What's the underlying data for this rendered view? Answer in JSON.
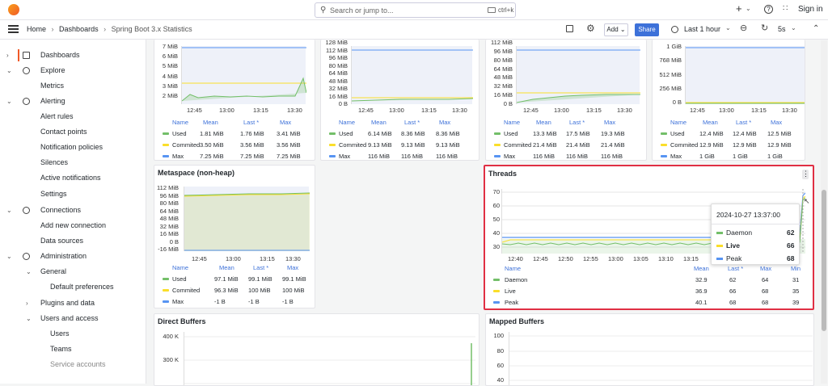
{
  "topbar": {
    "search_placeholder": "Search or jump to...",
    "shortcut": "ctrl+k",
    "plus": "+",
    "sign_in": "Sign in"
  },
  "breadcrumb": {
    "home": "Home",
    "sep1": "›",
    "dashboards": "Dashboards",
    "sep2": "›",
    "current": "Spring Boot 3.x Statistics"
  },
  "toolbar": {
    "add": "Add",
    "share": "Share",
    "time_range": "Last 1 hour",
    "refresh": "5s"
  },
  "sidebar": {
    "items": [
      {
        "label": "Dashboards",
        "chev": "›",
        "active": true
      },
      {
        "label": "Explore",
        "chev": "⌄"
      },
      {
        "label": "Metrics"
      },
      {
        "label": "Alerting",
        "chev": "⌄"
      },
      {
        "label": "Alert rules"
      },
      {
        "label": "Contact points"
      },
      {
        "label": "Notification policies"
      },
      {
        "label": "Silences"
      },
      {
        "label": "Active notifications"
      },
      {
        "label": "Settings"
      },
      {
        "label": "Connections",
        "chev": "⌄"
      },
      {
        "label": "Add new connection"
      },
      {
        "label": "Data sources"
      },
      {
        "label": "Administration",
        "chev": "⌄"
      },
      {
        "label": "General",
        "chev": "⌄"
      },
      {
        "label": "Default preferences"
      },
      {
        "label": "Plugins and data",
        "chev": "›"
      },
      {
        "label": "Users and access",
        "chev": "⌄"
      },
      {
        "label": "Users"
      },
      {
        "label": "Teams"
      },
      {
        "label": "Service accounts"
      }
    ]
  },
  "legend_headers": {
    "name": "Name",
    "mean": "Mean",
    "last": "Last *",
    "max": "Max",
    "min": "Min"
  },
  "legend_names": {
    "used": "Used",
    "committed": "Commited",
    "max": "Max"
  },
  "x_ticks_4": [
    "12:45",
    "13:00",
    "13:15",
    "13:30"
  ],
  "panel1": {
    "y_ticks": [
      "7 MiB",
      "6 MiB",
      "5 MiB",
      "4 MiB",
      "3 MiB",
      "2 MiB"
    ],
    "rows": [
      [
        "1.81 MiB",
        "1.76 MiB",
        "3.41 MiB"
      ],
      [
        "3.50 MiB",
        "3.56 MiB",
        "3.56 MiB"
      ],
      [
        "7.25 MiB",
        "7.25 MiB",
        "7.25 MiB"
      ]
    ]
  },
  "panel2": {
    "y_ticks": [
      "128 MiB",
      "112 MiB",
      "96 MiB",
      "80 MiB",
      "64 MiB",
      "48 MiB",
      "32 MiB",
      "16 MiB",
      "0 B"
    ],
    "rows": [
      [
        "6.14 MiB",
        "8.36 MiB",
        "8.36 MiB"
      ],
      [
        "9.13 MiB",
        "9.13 MiB",
        "9.13 MiB"
      ],
      [
        "116 MiB",
        "116 MiB",
        "116 MiB"
      ]
    ]
  },
  "panel3": {
    "y_ticks": [
      "112 MiB",
      "96 MiB",
      "80 MiB",
      "64 MiB",
      "48 MiB",
      "32 MiB",
      "16 MiB",
      "0 B"
    ],
    "rows": [
      [
        "13.3 MiB",
        "17.5 MiB",
        "19.3 MiB"
      ],
      [
        "21.4 MiB",
        "21.4 MiB",
        "21.4 MiB"
      ],
      [
        "116 MiB",
        "116 MiB",
        "116 MiB"
      ]
    ]
  },
  "panel4": {
    "y_ticks": [
      "1 GiB",
      "768 MiB",
      "512 MiB",
      "256 MiB",
      "0 B"
    ],
    "rows": [
      [
        "12.4 MiB",
        "12.4 MiB",
        "12.5 MiB"
      ],
      [
        "12.9 MiB",
        "12.9 MiB",
        "12.9 MiB"
      ],
      [
        "1 GiB",
        "1 GiB",
        "1 GiB"
      ]
    ]
  },
  "metaspace": {
    "title": "Metaspace (non-heap)",
    "y_ticks": [
      "112 MiB",
      "96 MiB",
      "80 MiB",
      "64 MiB",
      "48 MiB",
      "32 MiB",
      "16 MiB",
      "0 B",
      "-16 MiB"
    ],
    "rows": [
      [
        "97.1 MiB",
        "99.1 MiB",
        "99.1 MiB"
      ],
      [
        "96.3 MiB",
        "100 MiB",
        "100 MiB"
      ],
      [
        "-1 B",
        "-1 B",
        "-1 B"
      ]
    ]
  },
  "threads": {
    "title": "Threads",
    "y_ticks": [
      "70",
      "60",
      "50",
      "40",
      "30"
    ],
    "x_ticks": [
      "12:40",
      "12:45",
      "12:50",
      "12:55",
      "13:00",
      "13:05",
      "13:10",
      "13:15"
    ],
    "legend": [
      {
        "name": "Daemon",
        "mean": "32.9",
        "last": "62",
        "max": "64",
        "min": "31"
      },
      {
        "name": "Live",
        "mean": "36.9",
        "last": "66",
        "max": "68",
        "min": "35"
      },
      {
        "name": "Peak",
        "mean": "40.1",
        "last": "68",
        "max": "68",
        "min": "39"
      }
    ],
    "tooltip": {
      "time": "2024-10-27 13:37:00",
      "rows": [
        {
          "name": "Daemon",
          "value": "62"
        },
        {
          "name": "Live",
          "value": "66"
        },
        {
          "name": "Peak",
          "value": "68"
        }
      ]
    }
  },
  "direct_buffers": {
    "title": "Direct Buffers",
    "y_ticks": [
      "400 K",
      "300 K"
    ]
  },
  "mapped_buffers": {
    "title": "Mapped Buffers",
    "y_ticks": [
      "100",
      "80",
      "60",
      "40"
    ]
  },
  "colors": {
    "used": "#73bf69",
    "committed": "#fade2a",
    "max": "#5794f2",
    "accent": "#1f60c4",
    "highlight": "#e02f44"
  }
}
